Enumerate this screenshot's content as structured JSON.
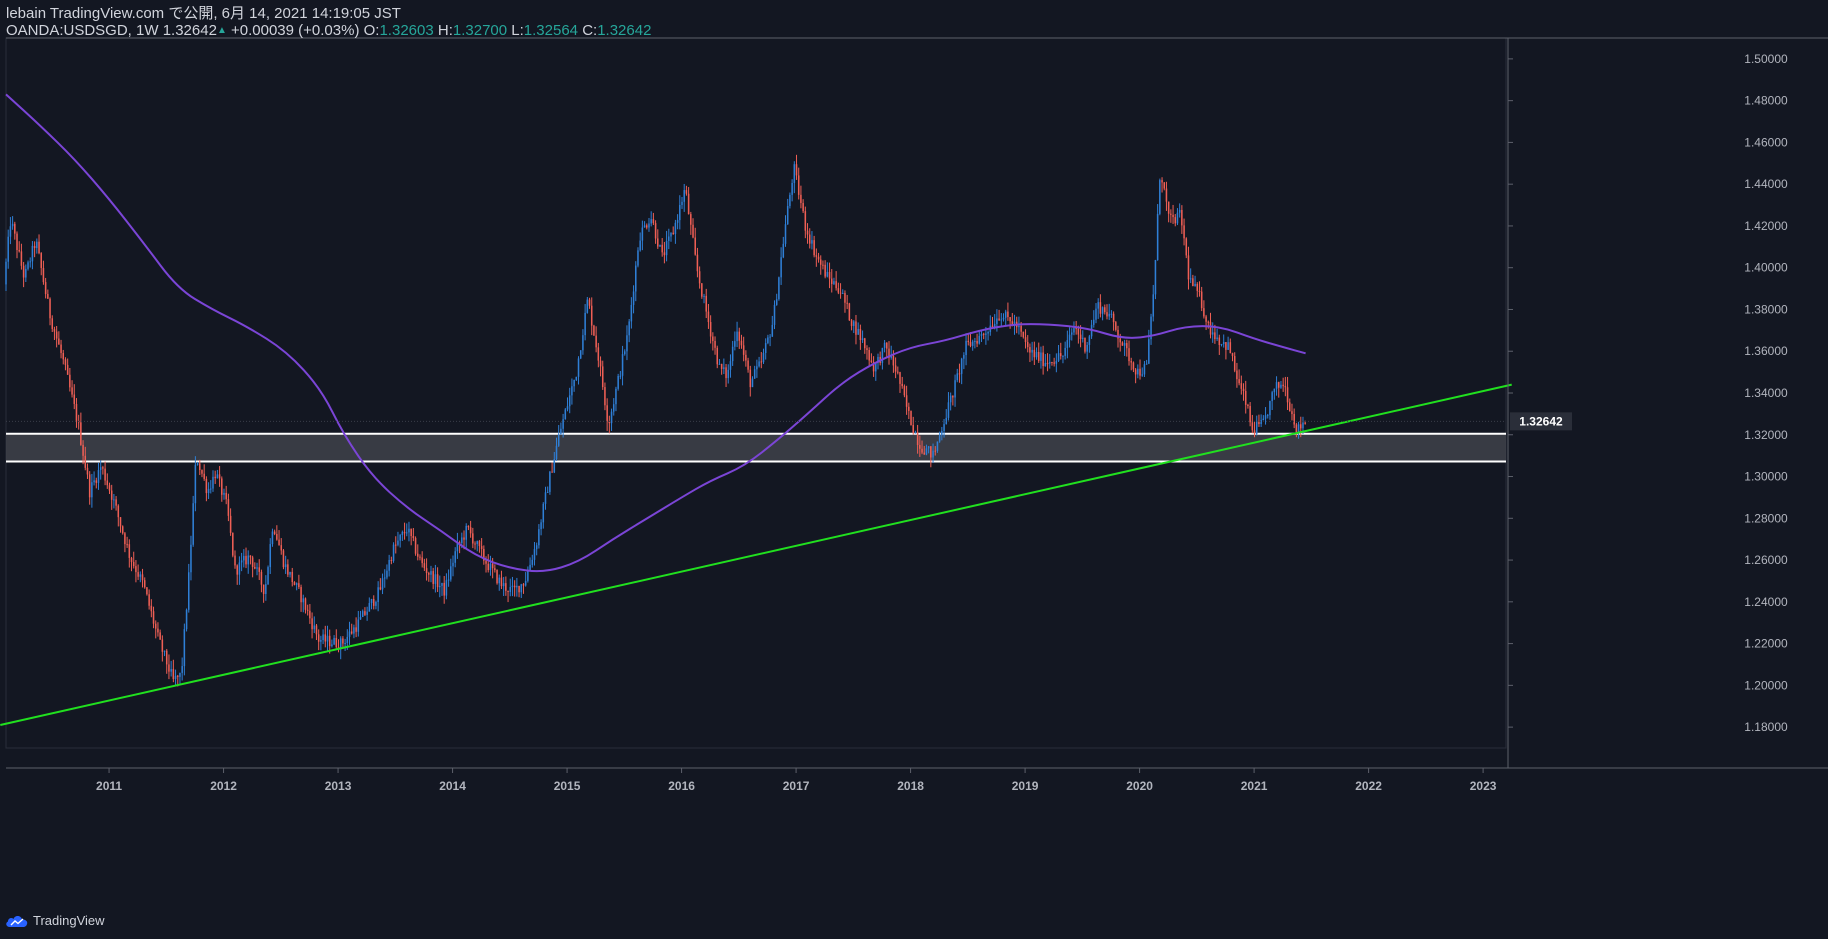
{
  "header": {
    "publish_line": "lebain TradingView.com で公開, 6月 14, 2021 14:19:05 JST",
    "symbol": "OANDA:USDSGD, 1W",
    "last_price": "1.32642",
    "change": "+0.00039 (+0.03%)",
    "o_label": "O:",
    "o_value": "1.32603",
    "h_label": "H:",
    "h_value": "1.32700",
    "l_label": "L:",
    "l_value": "1.32564",
    "c_label": "C:",
    "c_value": "1.32642"
  },
  "footer": {
    "brand": "TradingView",
    "brand_icon": "tradingview-cloud-icon"
  },
  "colors": {
    "background": "#131722",
    "up": "#2f7fd6",
    "down": "#ef5f55",
    "moving_average": "#7b45d6",
    "trendline": "#21e01f",
    "zone_fill": "#40424a",
    "zone_border": "#ffffff",
    "price_tag_bg": "#2a2e39"
  },
  "chart_data": {
    "type": "candlestick",
    "symbol": "OANDA:USDSGD",
    "timeframe": "1W",
    "xlim": [
      2010.1,
      2023.2
    ],
    "ylim": [
      1.17,
      1.51
    ],
    "x_ticks": [
      "2011",
      "2012",
      "2013",
      "2014",
      "2015",
      "2016",
      "2017",
      "2018",
      "2019",
      "2020",
      "2021",
      "2022",
      "2023"
    ],
    "y_ticks": [
      "1.18000",
      "1.20000",
      "1.22000",
      "1.24000",
      "1.26000",
      "1.28000",
      "1.30000",
      "1.32000",
      "1.34000",
      "1.36000",
      "1.38000",
      "1.40000",
      "1.42000",
      "1.44000",
      "1.46000",
      "1.48000",
      "1.50000"
    ],
    "last_price_label": "1.32642",
    "last_price": 1.32642,
    "price_path": [
      [
        2010.1,
        1.392
      ],
      [
        2010.16,
        1.423
      ],
      [
        2010.28,
        1.395
      ],
      [
        2010.38,
        1.413
      ],
      [
        2010.5,
        1.378
      ],
      [
        2010.62,
        1.355
      ],
      [
        2010.75,
        1.325
      ],
      [
        2010.85,
        1.293
      ],
      [
        2010.95,
        1.305
      ],
      [
        2011.05,
        1.29
      ],
      [
        2011.2,
        1.262
      ],
      [
        2011.32,
        1.248
      ],
      [
        2011.45,
        1.222
      ],
      [
        2011.58,
        1.202
      ],
      [
        2011.65,
        1.205
      ],
      [
        2011.72,
        1.255
      ],
      [
        2011.78,
        1.31
      ],
      [
        2011.88,
        1.293
      ],
      [
        2011.95,
        1.302
      ],
      [
        2012.05,
        1.285
      ],
      [
        2012.12,
        1.255
      ],
      [
        2012.25,
        1.262
      ],
      [
        2012.38,
        1.245
      ],
      [
        2012.45,
        1.278
      ],
      [
        2012.55,
        1.258
      ],
      [
        2012.7,
        1.242
      ],
      [
        2012.85,
        1.222
      ],
      [
        2013.05,
        1.22
      ],
      [
        2013.2,
        1.23
      ],
      [
        2013.38,
        1.245
      ],
      [
        2013.5,
        1.265
      ],
      [
        2013.62,
        1.275
      ],
      [
        2013.75,
        1.258
      ],
      [
        2013.95,
        1.245
      ],
      [
        2014.05,
        1.265
      ],
      [
        2014.15,
        1.275
      ],
      [
        2014.3,
        1.26
      ],
      [
        2014.45,
        1.248
      ],
      [
        2014.55,
        1.245
      ],
      [
        2014.65,
        1.25
      ],
      [
        2014.75,
        1.268
      ],
      [
        2014.85,
        1.295
      ],
      [
        2014.95,
        1.32
      ],
      [
        2015.1,
        1.35
      ],
      [
        2015.2,
        1.385
      ],
      [
        2015.3,
        1.355
      ],
      [
        2015.38,
        1.325
      ],
      [
        2015.45,
        1.342
      ],
      [
        2015.55,
        1.368
      ],
      [
        2015.65,
        1.415
      ],
      [
        2015.75,
        1.425
      ],
      [
        2015.85,
        1.405
      ],
      [
        2015.95,
        1.418
      ],
      [
        2016.05,
        1.438
      ],
      [
        2016.15,
        1.4
      ],
      [
        2016.25,
        1.375
      ],
      [
        2016.35,
        1.352
      ],
      [
        2016.42,
        1.348
      ],
      [
        2016.5,
        1.372
      ],
      [
        2016.62,
        1.345
      ],
      [
        2016.72,
        1.355
      ],
      [
        2016.82,
        1.375
      ],
      [
        2016.92,
        1.418
      ],
      [
        2017.0,
        1.448
      ],
      [
        2017.1,
        1.42
      ],
      [
        2017.2,
        1.405
      ],
      [
        2017.3,
        1.395
      ],
      [
        2017.4,
        1.39
      ],
      [
        2017.5,
        1.375
      ],
      [
        2017.6,
        1.365
      ],
      [
        2017.7,
        1.352
      ],
      [
        2017.8,
        1.362
      ],
      [
        2017.9,
        1.35
      ],
      [
        2018.0,
        1.33
      ],
      [
        2018.1,
        1.315
      ],
      [
        2018.22,
        1.31
      ],
      [
        2018.3,
        1.325
      ],
      [
        2018.4,
        1.342
      ],
      [
        2018.5,
        1.362
      ],
      [
        2018.65,
        1.368
      ],
      [
        2018.8,
        1.378
      ],
      [
        2018.95,
        1.372
      ],
      [
        2019.05,
        1.36
      ],
      [
        2019.2,
        1.355
      ],
      [
        2019.35,
        1.358
      ],
      [
        2019.45,
        1.372
      ],
      [
        2019.55,
        1.362
      ],
      [
        2019.65,
        1.382
      ],
      [
        2019.75,
        1.378
      ],
      [
        2019.9,
        1.36
      ],
      [
        2020.0,
        1.35
      ],
      [
        2020.08,
        1.352
      ],
      [
        2020.15,
        1.395
      ],
      [
        2020.2,
        1.448
      ],
      [
        2020.28,
        1.422
      ],
      [
        2020.38,
        1.425
      ],
      [
        2020.45,
        1.395
      ],
      [
        2020.55,
        1.385
      ],
      [
        2020.62,
        1.372
      ],
      [
        2020.72,
        1.365
      ],
      [
        2020.8,
        1.362
      ],
      [
        2020.88,
        1.345
      ],
      [
        2020.95,
        1.335
      ],
      [
        2021.0,
        1.322
      ],
      [
        2021.1,
        1.325
      ],
      [
        2021.2,
        1.342
      ],
      [
        2021.28,
        1.345
      ],
      [
        2021.35,
        1.33
      ],
      [
        2021.4,
        1.322
      ],
      [
        2021.45,
        1.3264
      ]
    ],
    "moving_average_path": [
      [
        2010.1,
        1.483
      ],
      [
        2010.4,
        1.468
      ],
      [
        2010.7,
        1.452
      ],
      [
        2011.0,
        1.433
      ],
      [
        2011.3,
        1.412
      ],
      [
        2011.6,
        1.39
      ],
      [
        2011.9,
        1.38
      ],
      [
        2012.2,
        1.372
      ],
      [
        2012.55,
        1.36
      ],
      [
        2012.85,
        1.342
      ],
      [
        2013.05,
        1.32
      ],
      [
        2013.3,
        1.3
      ],
      [
        2013.6,
        1.285
      ],
      [
        2013.9,
        1.274
      ],
      [
        2014.2,
        1.262
      ],
      [
        2014.5,
        1.256
      ],
      [
        2014.8,
        1.254
      ],
      [
        2015.1,
        1.259
      ],
      [
        2015.4,
        1.27
      ],
      [
        2015.7,
        1.28
      ],
      [
        2016.0,
        1.29
      ],
      [
        2016.25,
        1.298
      ],
      [
        2016.55,
        1.305
      ],
      [
        2016.85,
        1.318
      ],
      [
        2017.1,
        1.33
      ],
      [
        2017.4,
        1.345
      ],
      [
        2017.7,
        1.355
      ],
      [
        2018.0,
        1.362
      ],
      [
        2018.3,
        1.365
      ],
      [
        2018.6,
        1.37
      ],
      [
        2018.9,
        1.373
      ],
      [
        2019.2,
        1.373
      ],
      [
        2019.55,
        1.371
      ],
      [
        2019.85,
        1.366
      ],
      [
        2020.1,
        1.367
      ],
      [
        2020.4,
        1.372
      ],
      [
        2020.7,
        1.372
      ],
      [
        2021.0,
        1.366
      ],
      [
        2021.25,
        1.362
      ],
      [
        2021.45,
        1.359
      ]
    ],
    "trendline": {
      "start": [
        2010.05,
        1.181
      ],
      "end": [
        2023.25,
        1.344
      ]
    },
    "support_zone": {
      "upper": 1.3205,
      "lower": 1.3072
    }
  }
}
